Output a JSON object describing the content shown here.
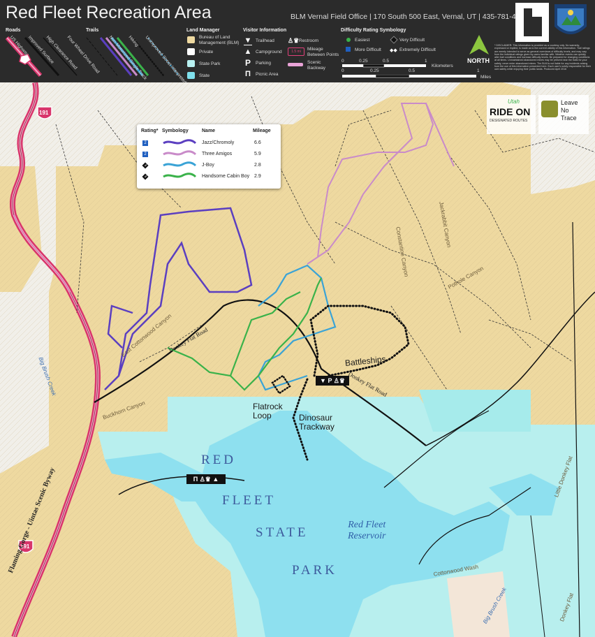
{
  "header": {
    "title": "Red Fleet Recreation Area",
    "office": "BLM Vernal Field Office | 170 South 500 East, Vernal, UT | 435-781-4400",
    "roads_heading": "Roads",
    "road_types": [
      "US Highway",
      "Improved Surface",
      "High Clearance Road"
    ],
    "trails_heading": "Trails",
    "trail_types": [
      "Four Wheel Drive Road",
      "Non-Motorized Single Track",
      "Hiking",
      "Unimproved Street Interpreted Trail"
    ],
    "land_manager_heading": "Land Manager",
    "land_managers": [
      {
        "label": "Bureau of Land Management (BLM)",
        "color": "#eed9a0"
      },
      {
        "label": "Private",
        "color": "#ffffff"
      },
      {
        "label": "State Park",
        "color": "#b8f0f0"
      },
      {
        "label": "State",
        "color": "#7fe0ec"
      }
    ],
    "visitor_heading": "Visitor Information",
    "visitor_items": [
      "Trailhead",
      "Campground",
      "Parking",
      "Picnic Area",
      "Restroom",
      "Mileage Between Points",
      "Scenic Backway"
    ],
    "mileage_sample": "1.5 mi",
    "difficulty_heading": "Difficulty Rating Symbology",
    "difficulty": [
      "Easiest",
      "Very Difficult",
      "More Difficult",
      "Extremely Difficult"
    ],
    "scale_km": [
      "0",
      "0.25",
      "0.5",
      "1",
      "Kilometers"
    ],
    "scale_mi": [
      "0",
      "0.25",
      "0.5",
      "1",
      "Miles"
    ],
    "north_label": "NORTH",
    "disclaimer": "* DISCLAIMER: This information is provided as a courtesy only. No warranty, expressed or implied, is made as to the current validity of this information. Trail ratings are merely intended to serve as general overviews of difficulty levels, and may vary from the individual ratings given by users familiar with. Weather events can quickly alter trail conditions and increase difficulty levels. Be prepared for changing conditions at all times. Unmaintained abandoned mines may be present near the trails for your safety, never enter abandoned mines. The BLM is not liable for any incidents arising from the use of this information presented here. Each user's solely responsible for their own safety while enjoying their public lands. Produced April 2016"
  },
  "logos": {
    "ride_on_a": "Utah",
    "ride_on_b": "RIDE ON",
    "ride_on_c": "DESIGNATED ROUTES",
    "lnt_a": "Leave",
    "lnt_b": "No",
    "lnt_c": "Trace"
  },
  "legend": {
    "headers": [
      "Rating*",
      "Symbology",
      "Name",
      "Mileage"
    ],
    "trails": [
      {
        "rating": "2",
        "name": "Jazz/Chromoly",
        "miles": "6.6",
        "color": "#5b3fc0"
      },
      {
        "rating": "2",
        "name": "Three Amigos",
        "miles": "5.9",
        "color": "#c98bc9"
      },
      {
        "rating": "3",
        "name": "J-Boy",
        "miles": "2.8",
        "color": "#3aa3d6"
      },
      {
        "rating": "3",
        "name": "Handsome Cabin Boy",
        "miles": "2.9",
        "color": "#3ab24a"
      }
    ]
  },
  "map_labels": {
    "flatrock": "Flatrock\nLoop",
    "dinosaur": "Dinosaur\nTrackway",
    "battleships": "Battleships",
    "park": [
      "RED",
      "FLEET",
      "STATE",
      "PARK"
    ],
    "reservoir": "Red Fleet\nReservoir",
    "hwy_shield": "191",
    "byway": "Flaming Gorge - Uintas Scenic Byway",
    "donkey1": "Donkey Flat Road",
    "donkey2": "Donkey Flat Road",
    "east_cottonwood": "East Cottonwood Canyon",
    "big_brush": "Big Brush Creek",
    "buckhorn": "Buckhorn Canyon",
    "constantine": "Constantine Canyon",
    "jackrabbit": "Jackrabbit Canyon",
    "pothole": "Pothole Canyon",
    "cottonwood_wash": "Cottonwood Wash",
    "big_brush_2": "Big Brush Creek",
    "little_donkey": "Little Donkey Flat",
    "donkey_flat": "Donkey Flat"
  }
}
